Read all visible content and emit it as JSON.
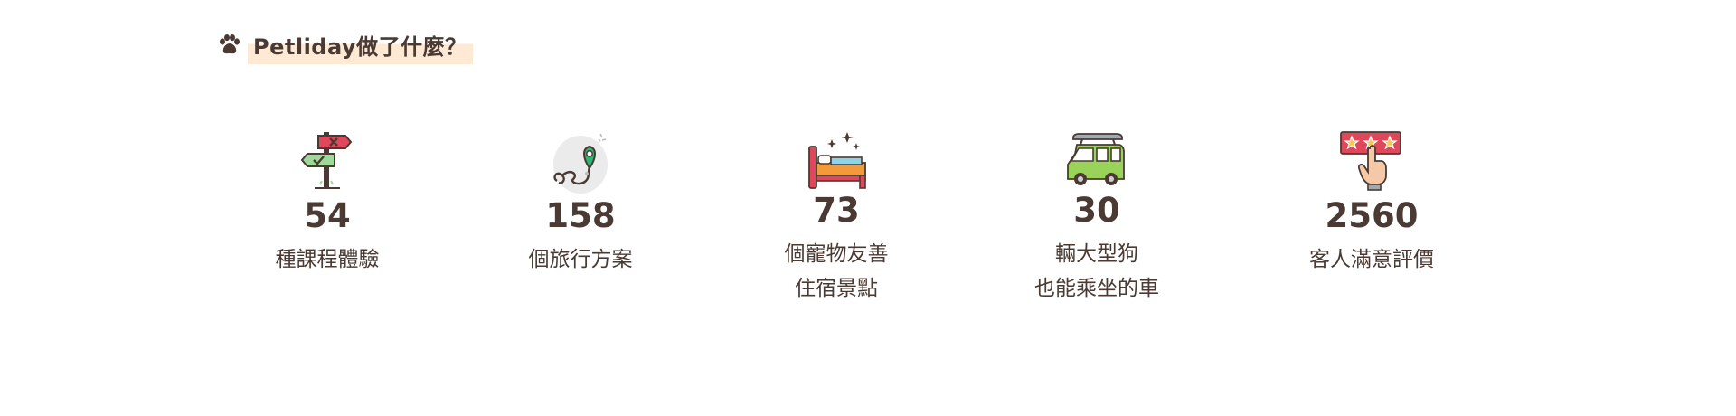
{
  "heading": {
    "icon": "paw-icon",
    "title": "Petliday做了什麼？"
  },
  "colors": {
    "text": "#4a3a33",
    "highlight": "#fde9d4",
    "sign_red": "#e0475b",
    "sign_green": "#9fd89a",
    "map_pin": "#2bb673",
    "car_green": "#9ad35a",
    "bed_orange": "#f39a3a",
    "stars_red": "#e0475b"
  },
  "stats": [
    {
      "icon": "signpost-icon",
      "number": "54",
      "label_lines": [
        "種課程體驗"
      ]
    },
    {
      "icon": "route-map-icon",
      "number": "158",
      "label_lines": [
        "個旅行方案"
      ]
    },
    {
      "icon": "bed-icon",
      "number": "73",
      "label_lines": [
        "個寵物友善",
        "住宿景點"
      ]
    },
    {
      "icon": "car-icon",
      "number": "30",
      "label_lines": [
        "輛大型狗",
        "也能乘坐的車"
      ]
    },
    {
      "icon": "rating-stars-icon",
      "number": "2560",
      "label_lines": [
        "客人滿意評價"
      ]
    }
  ]
}
